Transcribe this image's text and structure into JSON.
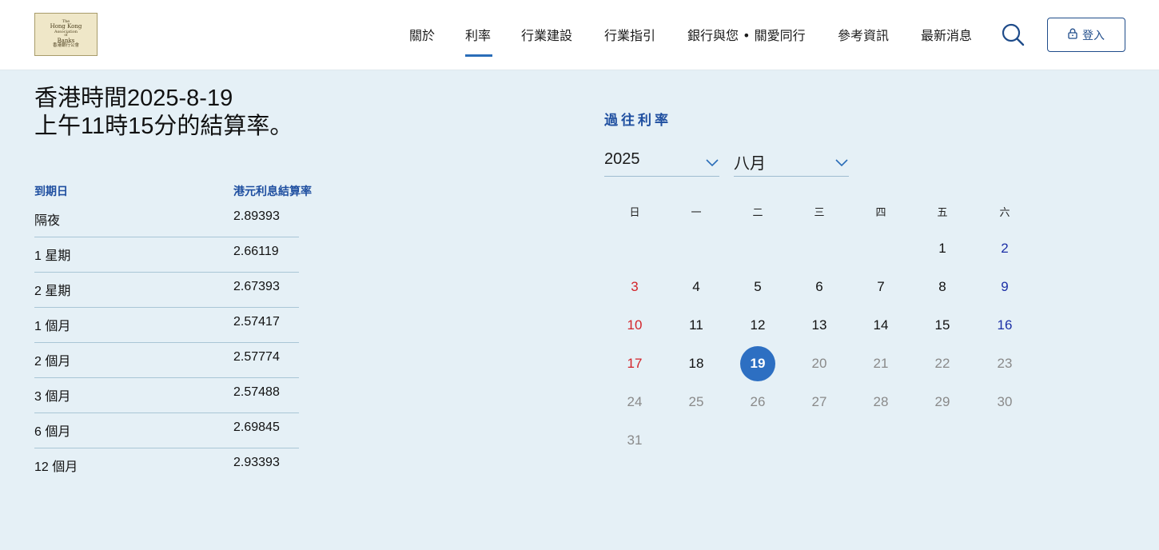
{
  "header": {
    "logo": {
      "lines": [
        "The",
        "Hong Kong",
        "Association",
        "of",
        "Banks",
        "香港銀行公會"
      ]
    },
    "nav": [
      {
        "label": "關於"
      },
      {
        "label": "利率",
        "active": true
      },
      {
        "label": "行業建設"
      },
      {
        "label": "行業指引"
      },
      {
        "label": "銀行與您 • 關愛同行"
      },
      {
        "label": "參考資訊"
      },
      {
        "label": "最新消息"
      }
    ],
    "search_icon": "search-icon",
    "login_label": "登入",
    "login_icon": "lock-icon"
  },
  "main": {
    "title_line1": "香港時間2025-8-19",
    "title_line2": "上午11時15分的結算率。",
    "rates": {
      "col_term": "到期日",
      "col_rate": "港元利息結算率",
      "rows": [
        {
          "term": "隔夜",
          "rate": "2.89393"
        },
        {
          "term": "1 星期",
          "rate": "2.66119"
        },
        {
          "term": "2 星期",
          "rate": "2.67393"
        },
        {
          "term": "1 個月",
          "rate": "2.57417"
        },
        {
          "term": "2 個月",
          "rate": "2.57774"
        },
        {
          "term": "3 個月",
          "rate": "2.57488"
        },
        {
          "term": "6 個月",
          "rate": "2.69845"
        },
        {
          "term": "12 個月",
          "rate": "2.93393"
        }
      ]
    }
  },
  "calendar": {
    "section_title": "過往利率",
    "year_select": "2025",
    "month_select": "八月",
    "weekdays": [
      "日",
      "一",
      "二",
      "三",
      "四",
      "五",
      "六"
    ],
    "weeks": [
      [
        null,
        null,
        null,
        null,
        null,
        "1",
        "2"
      ],
      [
        "3",
        "4",
        "5",
        "6",
        "7",
        "8",
        "9"
      ],
      [
        "10",
        "11",
        "12",
        "13",
        "14",
        "15",
        "16"
      ],
      [
        "17",
        "18",
        "19",
        "20",
        "21",
        "22",
        "23"
      ],
      [
        "24",
        "25",
        "26",
        "27",
        "28",
        "29",
        "30"
      ],
      [
        "31",
        null,
        null,
        null,
        null,
        null,
        null
      ]
    ],
    "selected_day": "19",
    "last_available_day": 19,
    "colors": {
      "sunday": "#d3242a",
      "saturday": "#1b2fa6",
      "future": "#8a8a8a",
      "selected": "#2d6fc2"
    }
  }
}
